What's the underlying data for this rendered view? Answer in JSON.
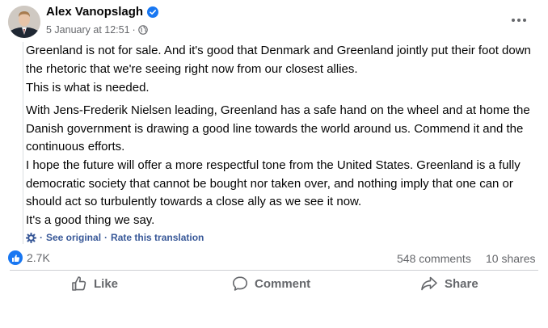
{
  "post": {
    "author": "Alex Vanopslagh",
    "timestamp": "5 January at 12:51",
    "meta_separator": "·",
    "paragraphs": [
      "Greenland is not for sale. And it's good that Denmark and Greenland jointly put their foot down the rhetoric that we're seeing right now from our closest allies.",
      "This is what is needed.",
      "With Jens-Frederik Nielsen leading, Greenland has a safe hand on the wheel and at home the Danish government is drawing a good line towards the world around us. Commend it and the continuous efforts.",
      "I hope the future will offer a more respectful tone from the United States. Greenland is a fully democratic society that cannot be bought nor taken over, and nothing imply that one can or should act so turbulently towards a close ally as we see it now.",
      "It's a good thing we say."
    ],
    "see_original": "See original",
    "rate_translation": "Rate this translation",
    "translate_separator": "·"
  },
  "stats": {
    "likes": "2.7K",
    "comments": "548 comments",
    "shares": "10 shares"
  },
  "actions": {
    "like": "Like",
    "comment": "Comment",
    "share": "Share"
  },
  "icons": {
    "verified": "verified-badge-icon",
    "globe": "globe-icon",
    "more": "more-options-icon",
    "gear": "gear-icon",
    "like_badge": "thumbs-up-icon",
    "like_action": "thumbs-up-outline-icon",
    "comment_action": "speech-bubble-icon",
    "share_action": "share-arrow-icon"
  },
  "colors": {
    "accent": "#1877f2",
    "link": "#385898",
    "secondary_text": "#65676b",
    "primary_text": "#050505"
  }
}
